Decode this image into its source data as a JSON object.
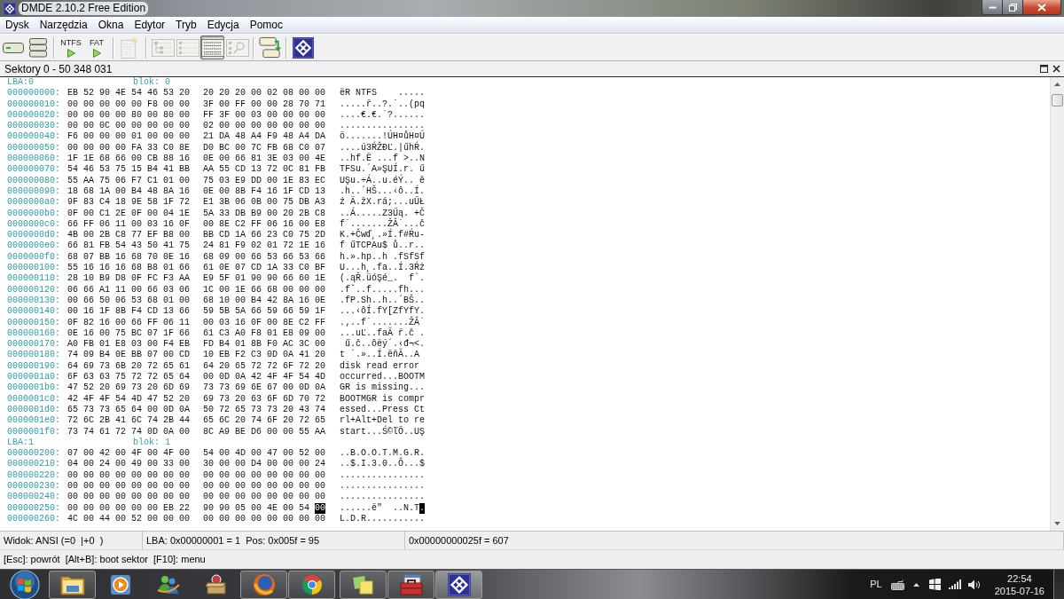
{
  "title_bar": {
    "title": "DMDE 2.10.2 Free Edition"
  },
  "menu": [
    "Dysk",
    "Narzędzia",
    "Okna",
    "Edytor",
    "Tryb",
    "Edycja",
    "Pomoc"
  ],
  "toolbar": {
    "groups": [
      {
        "buttons": [
          {
            "disabled": false
          },
          {
            "disabled": false
          }
        ]
      },
      {
        "buttons": [
          {
            "label": "NTFS",
            "disabled": false
          },
          {
            "label": "FAT",
            "disabled": false
          }
        ]
      },
      {
        "buttons": [
          {
            "disabled": true
          }
        ]
      },
      {
        "buttons": [
          {
            "disabled": true,
            "selected": false
          },
          {
            "disabled": true,
            "selected": false
          },
          {
            "disabled": false,
            "selected": true
          },
          {
            "disabled": true,
            "selected": false
          }
        ]
      },
      {
        "buttons": [
          {
            "disabled": false
          }
        ]
      },
      {
        "buttons": [
          {
            "disabled": false
          }
        ]
      }
    ]
  },
  "panel": {
    "title": "Sektory 0 - 50 348 031"
  },
  "hex_view": {
    "blocks": [
      {
        "lba": "LBA:0",
        "block": "blok: 0",
        "rows": [
          {
            "offset": "000000000:",
            "bytes": [
              "EB 52 90 4E 54 46 53 20",
              "20 20 20 00 02 08 00 00"
            ],
            "ascii": "ëR NTFS    ....."
          },
          {
            "offset": "000000010:",
            "bytes": [
              "00 00 00 00 00 F8 00 00",
              "3F 00 FF 00 00 28 70 71"
            ],
            "ascii": ".....ř..?.˙..(pq"
          },
          {
            "offset": "000000020:",
            "bytes": [
              "00 00 00 00 80 00 80 00",
              "FF 3F 00 03 00 00 00 00"
            ],
            "ascii": "....€.€.˙?......"
          },
          {
            "offset": "000000030:",
            "bytes": [
              "00 00 0C 00 00 00 00 00",
              "02 00 00 00 00 00 00 00"
            ],
            "ascii": "................"
          },
          {
            "offset": "000000040:",
            "bytes": [
              "F6 00 00 00 01 00 00 00",
              "21 DA 48 A4 F9 48 A4 DA"
            ],
            "ascii": "ö.......!ÚH¤ůH¤Ú"
          },
          {
            "offset": "000000050:",
            "bytes": [
              "00 00 00 00 FA 33 C0 8E",
              "D0 BC 00 7C FB 68 C0 07"
            ],
            "ascii": "....ú3ŔŽĐĽ.|űhŔ."
          },
          {
            "offset": "000000060:",
            "bytes": [
              "1F 1E 68 66 00 CB 88 16",
              "0E 00 66 81 3E 03 00 4E"
            ],
            "ascii": "..hf.Ë ...f >..N"
          },
          {
            "offset": "000000070:",
            "bytes": [
              "54 46 53 75 15 B4 41 BB",
              "AA 55 CD 13 72 0C 81 FB"
            ],
            "ascii": "TFSu.´A»ŞUÍ.r. ű"
          },
          {
            "offset": "000000080:",
            "bytes": [
              "55 AA 75 06 F7 C1 01 00",
              "75 03 E9 DD 00 1E 83 EC"
            ],
            "ascii": "UŞu.÷Á..u.éÝ.. ě"
          },
          {
            "offset": "000000090:",
            "bytes": [
              "18 68 1A 00 B4 48 8A 16",
              "0E 00 8B F4 16 1F CD 13"
            ],
            "ascii": ".h..´HŠ...‹ô..Í."
          },
          {
            "offset": "0000000a0:",
            "bytes": [
              "9F 83 C4 18 9E 58 1F 72",
              "E1 3B 06 0B 00 75 DB A3"
            ],
            "ascii": "ź Ä.žX.rá;...uŰŁ"
          },
          {
            "offset": "0000000b0:",
            "bytes": [
              "0F 00 C1 2E 0F 00 04 1E",
              "5A 33 DB B9 00 20 2B C8"
            ],
            "ascii": "..Á.....Z3Űą. +Č"
          },
          {
            "offset": "0000000c0:",
            "bytes": [
              "66 FF 06 11 00 03 16 0F",
              "00 8E C2 FF 06 16 00 E8"
            ],
            "ascii": "f˙.......ŽÂ˙...č"
          },
          {
            "offset": "0000000d0:",
            "bytes": [
              "4B 00 2B C8 77 EF B8 00",
              "BB CD 1A 66 23 C0 75 2D"
            ],
            "ascii": "K.+Čwď¸.»Í.f#Ŕu-"
          },
          {
            "offset": "0000000e0:",
            "bytes": [
              "66 81 FB 54 43 50 41 75",
              "24 81 F9 02 01 72 1E 16"
            ],
            "ascii": "f űTCPAu$ ů..r.."
          },
          {
            "offset": "0000000f0:",
            "bytes": [
              "68 07 BB 16 68 70 0E 16",
              "68 09 00 66 53 66 53 66"
            ],
            "ascii": "h.».hp..h .fSfSf"
          },
          {
            "offset": "000000100:",
            "bytes": [
              "55 16 16 16 68 B8 01 66",
              "61 0E 07 CD 1A 33 C0 BF"
            ],
            "ascii": "U...h¸.fa..Í.3Ŕż"
          },
          {
            "offset": "000000110:",
            "bytes": [
              "28 10 B9 D8 0F FC F3 AA",
              "E9 5F 01 90 90 66 60 1E"
            ],
            "ascii": "(.ąŘ.üóŞé_.  f`."
          },
          {
            "offset": "000000120:",
            "bytes": [
              "06 66 A1 11 00 66 03 06",
              "1C 00 1E 66 68 00 00 00"
            ],
            "ascii": ".fˇ..f.....fh..."
          },
          {
            "offset": "000000130:",
            "bytes": [
              "00 66 50 06 53 68 01 00",
              "68 10 00 B4 42 8A 16 0E"
            ],
            "ascii": ".fP.Sh..h..´BŠ.."
          },
          {
            "offset": "000000140:",
            "bytes": [
              "00 16 1F 8B F4 CD 13 66",
              "59 5B 5A 66 59 66 59 1F"
            ],
            "ascii": "...‹ôÍ.fY[ZfYfY."
          },
          {
            "offset": "000000150:",
            "bytes": [
              "0F 82 16 00 66 FF 06 11",
              "00 03 16 0F 00 8E C2 FF"
            ],
            "ascii": ".‚..f˙.......ŽÂ˙"
          },
          {
            "offset": "000000160:",
            "bytes": [
              "0E 16 00 75 BC 07 1F 66",
              "61 C3 A0 F8 01 E8 09 00"
            ],
            "ascii": "...uĽ..faĂ ř.č ."
          },
          {
            "offset": "000000170:",
            "bytes": [
              "A0 FB 01 E8 03 00 F4 EB",
              "FD B4 01 8B F0 AC 3C 00"
            ],
            "ascii": " ű.č..ôëý´.‹đ¬<."
          },
          {
            "offset": "000000180:",
            "bytes": [
              "74 09 B4 0E BB 07 00 CD",
              "10 EB F2 C3 0D 0A 41 20"
            ],
            "ascii": "t ´.»..Í.ëňĂ..A"
          },
          {
            "offset": "000000190:",
            "bytes": [
              "64 69 73 6B 20 72 65 61",
              "64 20 65 72 72 6F 72 20"
            ],
            "ascii": "disk read error"
          },
          {
            "offset": "0000001a0:",
            "bytes": [
              "6F 63 63 75 72 72 65 64",
              "00 0D 0A 42 4F 4F 54 4D"
            ],
            "ascii": "occurred...BOOTM"
          },
          {
            "offset": "0000001b0:",
            "bytes": [
              "47 52 20 69 73 20 6D 69",
              "73 73 69 6E 67 00 0D 0A"
            ],
            "ascii": "GR is missing..."
          },
          {
            "offset": "0000001c0:",
            "bytes": [
              "42 4F 4F 54 4D 47 52 20",
              "69 73 20 63 6F 6D 70 72"
            ],
            "ascii": "BOOTMGR is compr"
          },
          {
            "offset": "0000001d0:",
            "bytes": [
              "65 73 73 65 64 00 0D 0A",
              "50 72 65 73 73 20 43 74"
            ],
            "ascii": "essed...Press Ct"
          },
          {
            "offset": "0000001e0:",
            "bytes": [
              "72 6C 2B 41 6C 74 2B 44",
              "65 6C 20 74 6F 20 72 65"
            ],
            "ascii": "rl+Alt+Del to re"
          },
          {
            "offset": "0000001f0:",
            "bytes": [
              "73 74 61 72 74 0D 0A 00",
              "8C A9 BE D6 00 00 55 AA"
            ],
            "ascii": "start...Ś©ľÖ..UŞ"
          }
        ]
      },
      {
        "lba": "LBA:1",
        "block": "blok: 1",
        "rows": [
          {
            "offset": "000000200:",
            "bytes": [
              "07 00 42 00 4F 00 4F 00",
              "54 00 4D 00 47 00 52 00"
            ],
            "ascii": "..B.O.O.T.M.G.R."
          },
          {
            "offset": "000000210:",
            "bytes": [
              "04 00 24 00 49 00 33 00",
              "30 00 00 D4 00 00 00 24"
            ],
            "ascii": "..$.I.3.0..Ô...$"
          },
          {
            "offset": "000000220:",
            "bytes": [
              "00 00 00 00 00 00 00 00",
              "00 00 00 00 00 00 00 00"
            ],
            "ascii": "................"
          },
          {
            "offset": "000000230:",
            "bytes": [
              "00 00 00 00 00 00 00 00",
              "00 00 00 00 00 00 00 00"
            ],
            "ascii": "................"
          },
          {
            "offset": "000000240:",
            "bytes": [
              "00 00 00 00 00 00 00 00",
              "00 00 00 00 00 00 00 00"
            ],
            "ascii": "................"
          },
          {
            "offset": "000000250:",
            "bytes": [
              "00 00 00 00 00 00 EB 22",
              "90 90 05 00 4E 00 54"
            ],
            "ascii": "......ë\"  ..N.T",
            "cursor": {
              "byte": "00",
              "char": "."
            }
          },
          {
            "offset": "000000260:",
            "bytes": [
              "4C 00 44 00 52 00 00 00",
              "00 00 00 00 00 00 00 00"
            ],
            "ascii": "L.D.R..........."
          }
        ]
      }
    ]
  },
  "status_bar": [
    "Widok: ANSI (=0  |+0  )",
    "LBA: 0x00000001 = 1  Pos: 0x005f = 95",
    "0x00000000025f = 607"
  ],
  "help_bar": "[Esc]: powrót  [Alt+B]: boot sektor  [F10]: menu",
  "taskbar": {
    "apps": [
      {
        "running": true,
        "selected": false
      },
      {
        "running": false,
        "selected": false
      },
      {
        "running": false,
        "selected": false
      },
      {
        "running": false,
        "selected": false
      },
      {
        "running": true,
        "selected": false
      },
      {
        "running": true,
        "selected": false
      },
      {
        "running": true,
        "selected": false
      },
      {
        "running": true,
        "selected": false
      },
      {
        "running": true,
        "selected": true
      }
    ],
    "tray": {
      "language": "PL",
      "time": "22:54",
      "date": "2015-07-16"
    }
  }
}
